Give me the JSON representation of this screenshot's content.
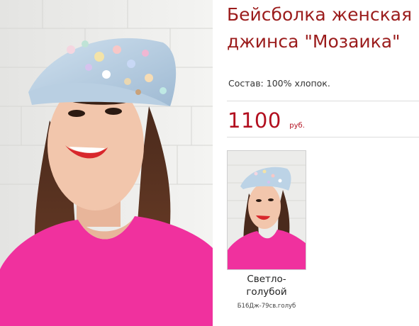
{
  "product": {
    "title": "Бейсболка женская джинса \"Мозаика\"",
    "composition": "Состав: 100% хлопок.",
    "price": "1100",
    "currency": "руб.",
    "accent_color": "#b20e1e",
    "title_color": "#9b1c1c",
    "main_image": "woman-wearing-light-blue-denim-cap-photo"
  },
  "variants": [
    {
      "color_name": "Светло-голубой",
      "article": "Б16Дж-79св.голуб",
      "image": "woman-in-cap-thumbnail-photo"
    }
  ]
}
